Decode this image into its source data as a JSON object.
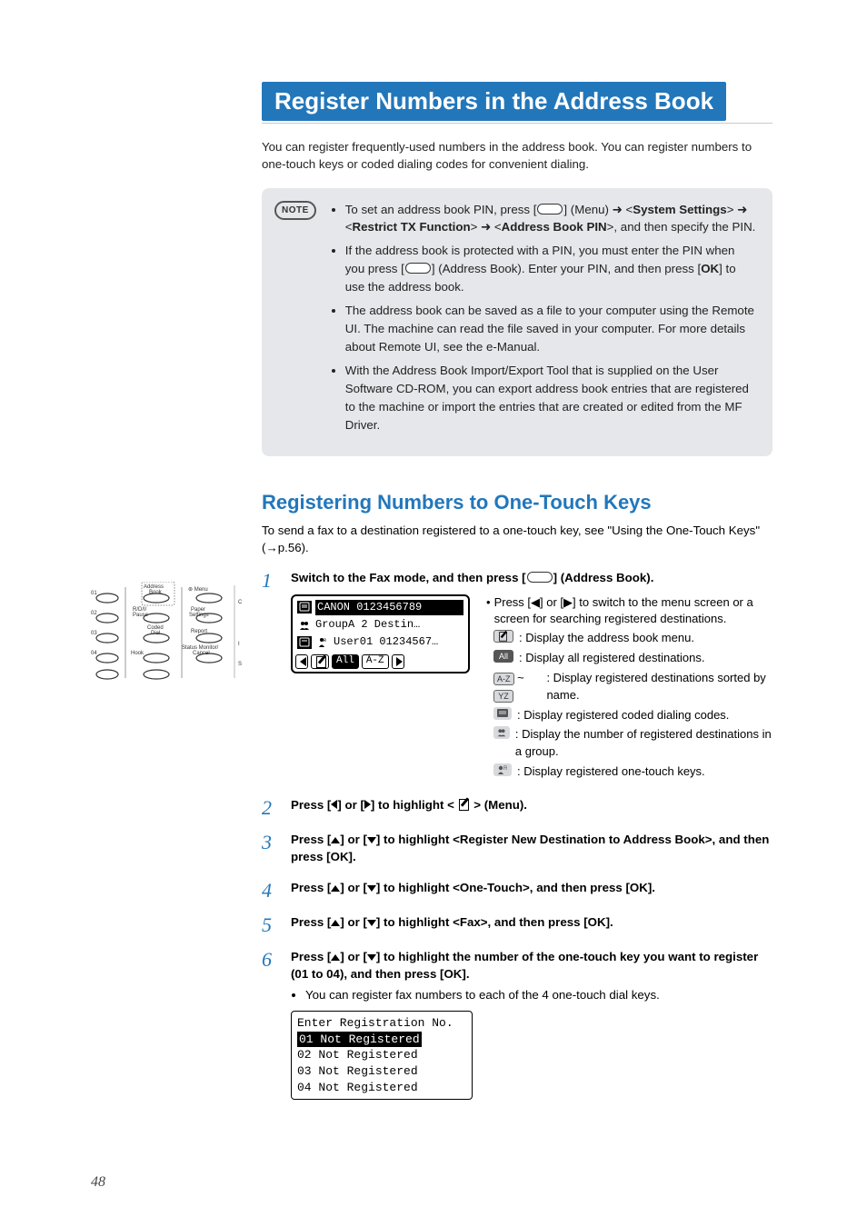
{
  "page_number": "48",
  "title": "Register Numbers in the Address Book",
  "intro": "You can register frequently-used numbers in the address book. You can register numbers to one-touch keys or coded dialing codes for convenient dialing.",
  "note_label": "NOTE",
  "note": {
    "b1_pre": "To set an address book PIN, press [",
    "b1_img": "] (Menu) ",
    "b1_bold1": "System Settings",
    "b1_bold2": "Restrict TX Function",
    "b1_bold3": "Address Book PIN",
    "b1_post": ", and then specify the PIN.",
    "b2_pre": "If the address book is protected with a PIN, you must enter the PIN when you press [",
    "b2_mid": "] (Address Book). Enter your PIN, and then press [",
    "b2_bold": "OK",
    "b2_post": "] to use the address book.",
    "b3": "The address book can be saved as a file to your computer using the Remote UI. The machine can read the file saved in your computer. For more details about Remote UI, see the e-Manual.",
    "b4": "With the Address Book Import/Export Tool that is supplied on the User Software CD-ROM, you can export address book entries that are registered to the machine or import the entries that are created or edited from the MF Driver."
  },
  "section": {
    "title": "Registering Numbers to One-Touch Keys",
    "desc_pre": "To send a fax to a destination registered to a one-touch key, see \"Using the One-Touch Keys\" (",
    "desc_link": "→p.56",
    "desc_post": ")."
  },
  "lcd": {
    "r1": "CANON 0123456789",
    "r2": "GroupA 2 Destin…",
    "r3": "User01 01234567…",
    "tab_all": "All",
    "tab_az": "A-Z"
  },
  "step1": {
    "head_pre": "Switch to the Fax mode, and then press [",
    "head_post": "] (Address Book).",
    "bullet1": "Press [◀] or [▶] to switch to the menu screen or a screen for searching registered destinations.",
    "leg_menu": ": Display the address book menu.",
    "leg_all": ": Display all registered destinations.",
    "leg_all_label": "All",
    "leg_az1": "A-Z",
    "leg_az2": "YZ",
    "leg_sort": ": Display registered destinations sorted by name.",
    "leg_coded": ": Display registered coded dialing codes.",
    "leg_group": ": Display the number of registered destinations in a group.",
    "leg_one": ": Display registered one-touch keys."
  },
  "step2": {
    "text_pre": "Press [",
    "text_mid": "] or [",
    "text_post": "] to highlight < ",
    "text_end": " > (Menu)."
  },
  "step3": {
    "text_pre": "Press [",
    "text_mid": "] or [",
    "text_post": "] to highlight <Register New Destination to Address Book>, and then press [OK]."
  },
  "step4": {
    "text_pre": "Press [",
    "text_mid": "] or [",
    "text_post": "] to highlight <One-Touch>, and then press [OK]."
  },
  "step5": {
    "text_pre": "Press [",
    "text_mid": "] or [",
    "text_post": "] to highlight <Fax>, and then press [OK]."
  },
  "step6": {
    "text_pre": "Press [",
    "text_mid": "] or [",
    "text_post": "] to highlight the number of the one-touch key you want to register (01 to 04), and then press [OK].",
    "sub": "You can register fax numbers to each of the 4 one-touch dial keys."
  },
  "lcd2": {
    "title": "Enter Registration No.",
    "r1": "01 Not Registered",
    "r2": "02 Not Registered",
    "r3": "03 Not Registered",
    "r4": "04 Not Registered"
  },
  "panel_labels": {
    "addr": "Address Book",
    "menu": "Menu",
    "paper": "Paper Settings",
    "coded": "Coded Dial",
    "report": "Report",
    "hook": "Hook",
    "status": "Status Monitor/ Cancel",
    "rdp": "R/D/I/",
    "pause": "Pause"
  }
}
